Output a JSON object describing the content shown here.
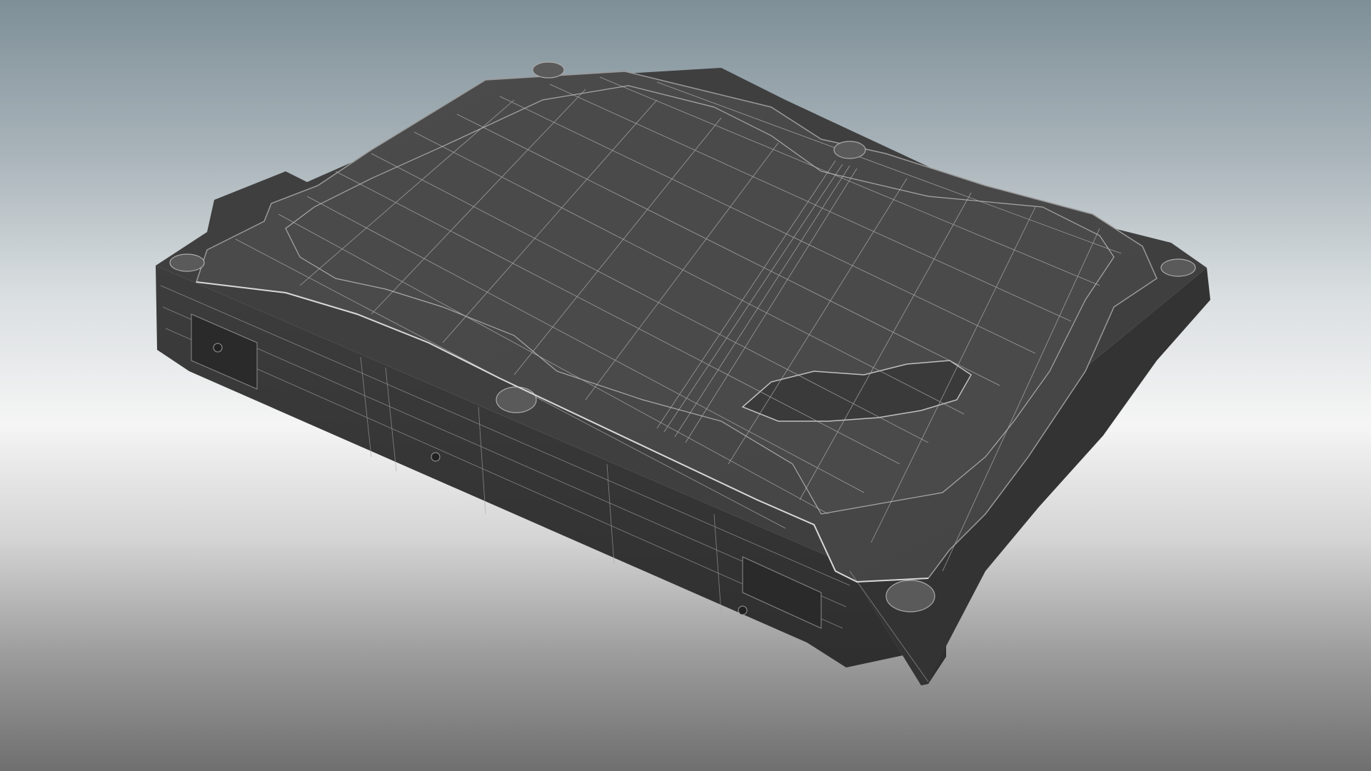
{
  "viewport": {
    "background_top": "#7e8f97",
    "background_mid": "#f5f5f5",
    "background_bottom": "#6f6f6f"
  },
  "model": {
    "subject": "hard-disk-drive",
    "shading": "wireframe-on-shaded",
    "base_color": "#4a4a4a",
    "side_color": "#3a3a3a",
    "wire_color": "#bfbfbf"
  }
}
